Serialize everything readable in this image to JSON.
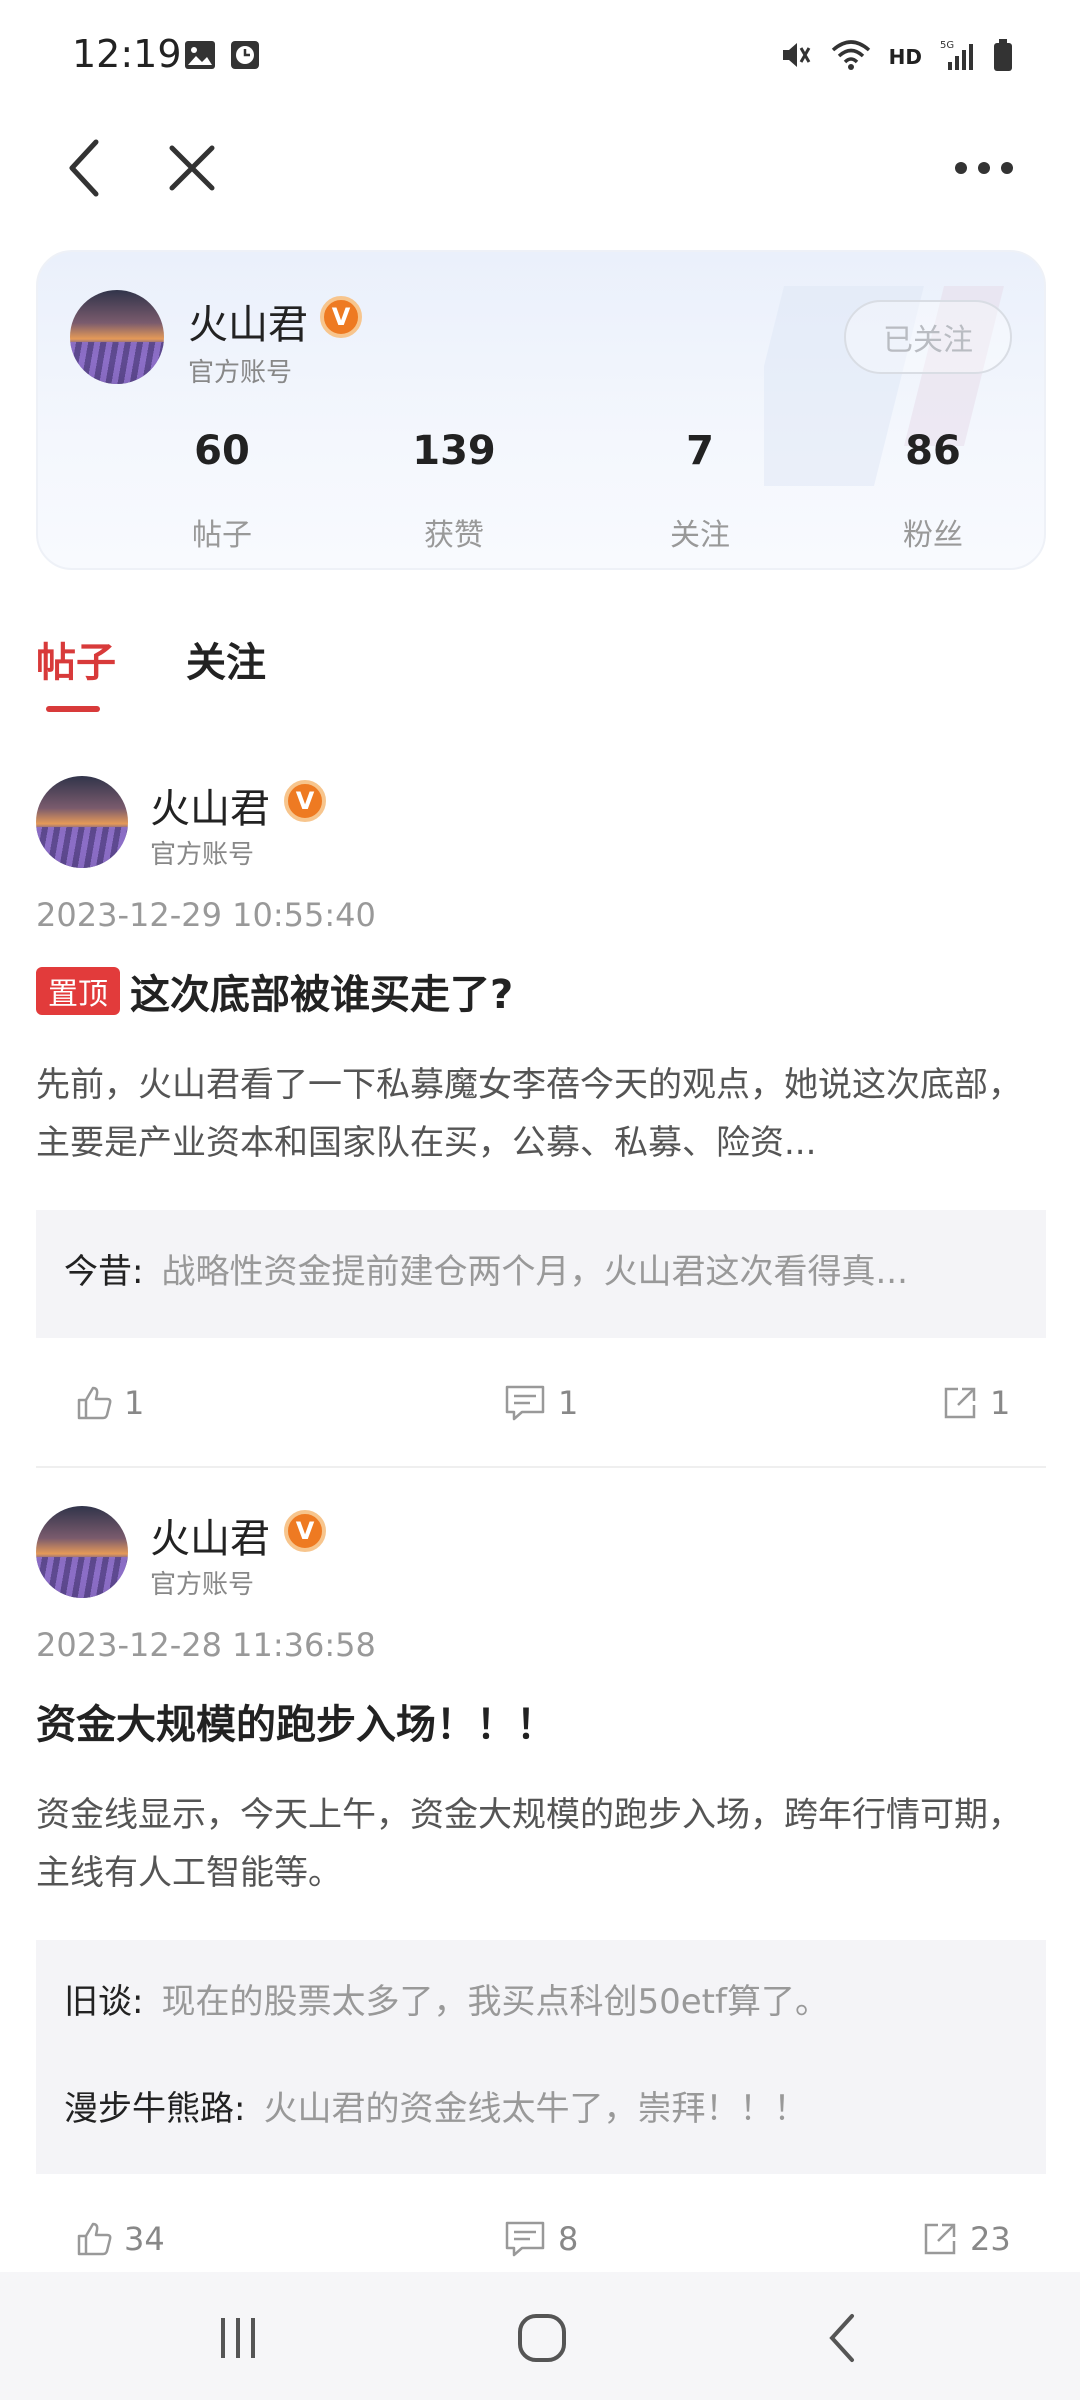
{
  "status_bar": {
    "time": "12:19",
    "network": "HD"
  },
  "nav": {
    "back_icon": "back-arrow-icon",
    "close_icon": "close-icon",
    "more_icon": "more-dots-icon"
  },
  "profile": {
    "name": "火山君",
    "verified_badge": "V",
    "subtitle": "官方账号",
    "follow_button": "已关注",
    "stats": [
      {
        "value": "60",
        "label": "帖子"
      },
      {
        "value": "139",
        "label": "获赞"
      },
      {
        "value": "7",
        "label": "关注"
      },
      {
        "value": "86",
        "label": "粉丝"
      }
    ]
  },
  "tabs": [
    {
      "label": "帖子",
      "active": true
    },
    {
      "label": "关注",
      "active": false
    }
  ],
  "posts": [
    {
      "author": "火山君",
      "badge": "V",
      "subtitle": "官方账号",
      "time": "2023-12-29 10:55:40",
      "pin_tag": "置顶",
      "title": "这次底部被谁买走了?",
      "body": "先前，火山君看了一下私募魔女李蓓今天的观点，她说这次底部，主要是产业资本和国家队在买，公募、私募、险资...",
      "comments": [
        {
          "author": "今昔:",
          "text": "战略性资金提前建仓两个月，火山君这次看得真..."
        }
      ],
      "likes": "1",
      "comment_count": "1",
      "shares": "1"
    },
    {
      "author": "火山君",
      "badge": "V",
      "subtitle": "官方账号",
      "time": "2023-12-28 11:36:58",
      "title": "资金大规模的跑步入场！！！",
      "body": "资金线显示，今天上午，资金大规模的跑步入场，跨年行情可期，主线有人工智能等。",
      "comments": [
        {
          "author": "旧谈:",
          "text": "现在的股票太多了，我买点科创50etf算了。"
        },
        {
          "author": "漫步牛熊路:",
          "text": "火山君的资金线太牛了，崇拜！！！"
        }
      ],
      "likes": "34",
      "comment_count": "8",
      "shares": "23"
    }
  ],
  "colors": {
    "accent": "#d83a3a",
    "badge": "#ee7a22",
    "pin": "#e23b3b"
  }
}
